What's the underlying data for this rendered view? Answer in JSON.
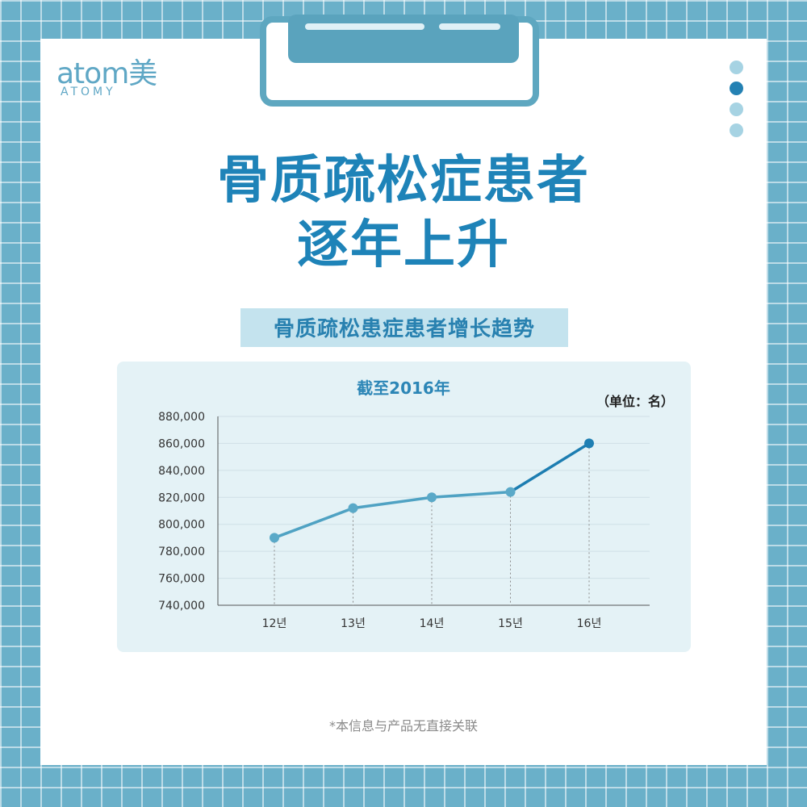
{
  "brand": {
    "wordmark": "atom美",
    "subtitle": "ATOMY"
  },
  "page": {
    "title_line1": "骨质疏松症患者",
    "title_line2": "逐年上升",
    "subtitle": "骨质疏松患症患者增长趋势",
    "footnote": "*本信息与产品无直接关联"
  },
  "pagination": {
    "count": 4,
    "active_index": 1
  },
  "colors": {
    "title": "#1e83b8",
    "line": "#4fa2c3",
    "line_last": "#1c7db1",
    "point": "#5aa9c8",
    "point_last": "#1f7fb3",
    "grid": "#cfdfe6"
  },
  "chart_data": {
    "type": "line",
    "title": "截至2016年",
    "unit_label": "（单位：名）",
    "categories": [
      "12년",
      "13년",
      "14년",
      "15년",
      "16년"
    ],
    "values": [
      790000,
      812000,
      820000,
      824000,
      860000
    ],
    "ylim": [
      740000,
      880000
    ],
    "yticks": [
      740000,
      760000,
      780000,
      800000,
      820000,
      840000,
      860000,
      880000
    ],
    "ytick_labels": [
      "740,000",
      "760,000",
      "780,000",
      "800,000",
      "820,000",
      "840,000",
      "860,000",
      "880,000"
    ],
    "grid": true,
    "xlabel": "",
    "ylabel": ""
  }
}
